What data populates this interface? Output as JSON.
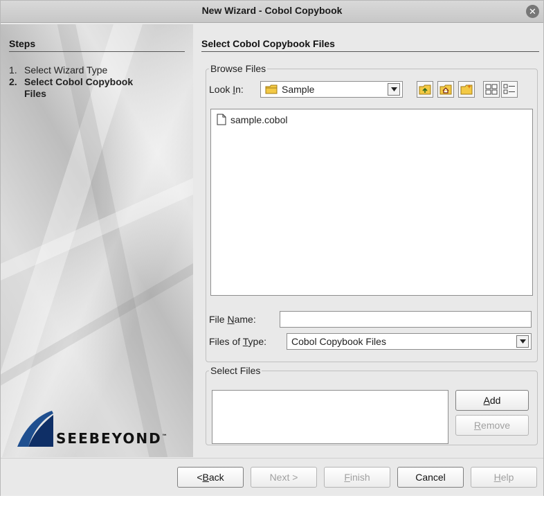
{
  "window": {
    "title": "New Wizard - Cobol Copybook",
    "close_icon": "close-icon"
  },
  "steps": {
    "header": "Steps",
    "items": [
      {
        "num": "1.",
        "label": "Select Wizard Type",
        "current": false
      },
      {
        "num": "2.",
        "label": "Select Cobol Copybook Files",
        "current": true
      }
    ]
  },
  "logo": {
    "text": "SEEBEYOND",
    "tm": "™"
  },
  "page": {
    "title": "Select Cobol Copybook Files"
  },
  "browse": {
    "legend": "Browse Files",
    "look_in": {
      "label_pre": "Look ",
      "label_mnemonic": "I",
      "label_post": "n:",
      "value": "Sample"
    },
    "toolbar_icons": [
      "up-folder-icon",
      "home-folder-icon",
      "new-folder-icon",
      "list-view-icon",
      "details-view-icon"
    ],
    "files": [
      {
        "name": "sample.cobol",
        "icon": "file-icon"
      }
    ],
    "file_name": {
      "label_pre": "File ",
      "label_mnemonic": "N",
      "label_post": "ame:",
      "value": ""
    },
    "files_of_type": {
      "label_pre": "Files of ",
      "label_mnemonic": "T",
      "label_post": "ype:",
      "value": "Cobol Copybook Files"
    }
  },
  "select_files": {
    "legend": "Select Files",
    "add": {
      "mnemonic": "A",
      "rest": "dd"
    },
    "remove": {
      "mnemonic": "R",
      "rest": "emove"
    }
  },
  "footer": {
    "back": {
      "pre": "< ",
      "mnemonic": "B",
      "rest": "ack"
    },
    "next": "Next >",
    "finish": {
      "mnemonic": "F",
      "rest": "inish"
    },
    "cancel": "Cancel",
    "help": {
      "mnemonic": "H",
      "rest": "elp"
    }
  },
  "colors": {
    "window_bg": "#e9e9e9",
    "logo_blue": "#1f4f8f"
  }
}
